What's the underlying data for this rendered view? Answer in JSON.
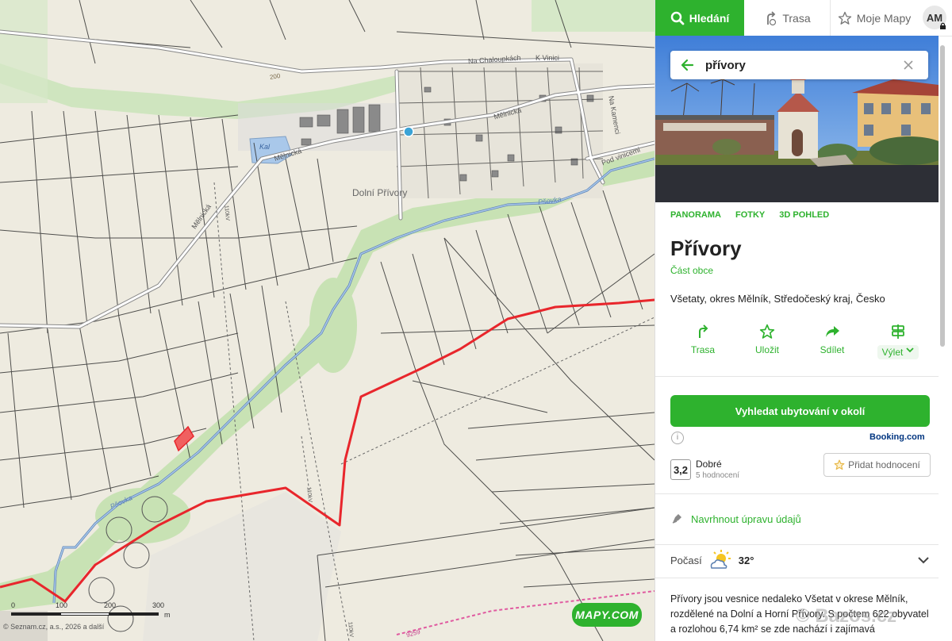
{
  "map": {
    "labels": {
      "village": "Dolní Přívory",
      "street_melnicka_1": "Mělnická",
      "street_melnicka_2": "Mělnická",
      "street_melnicka_3": "Mělnická",
      "street_chaloupkach": "Na Chaloupkách",
      "street_k_vinici": "K Vinici",
      "street_kamenci": "Na Kamenci",
      "street_pod_vinicemi": "Pod vinicemi",
      "stream_1": "Pšovka",
      "stream_2": "Pšovka",
      "pond": "Kal",
      "contour_200": "200",
      "powerline_1": "110kV",
      "powerline_2": "110kV",
      "powerline_3": "110kV",
      "road_num": "9259"
    },
    "scale": {
      "labels": [
        "0",
        "100",
        "200",
        "300"
      ],
      "unit": "m"
    },
    "copyright": "© Seznam.cz, a.s., 2026 a další",
    "logo": "MAPY.COM",
    "colors": {
      "route": "#e8262c",
      "stream": "#7f9fc4",
      "green": "#bfe0a8",
      "land": "#eeebe0"
    }
  },
  "panel": {
    "tabs": {
      "search": "Hledání",
      "route": "Trasa",
      "my_maps": "Moje Mapy"
    },
    "avatar": "AM",
    "search": {
      "query": "přívory"
    },
    "photo_links": {
      "panorama": "PANORAMA",
      "photos": "FOTKY",
      "view3d": "3D POHLED"
    },
    "place": {
      "title": "Přívory",
      "subtitle": "Část obce",
      "address": "Všetaty, okres Mělník, Středočeský kraj, Česko"
    },
    "actions": {
      "route": "Trasa",
      "save": "Uložit",
      "share": "Sdílet",
      "trip": "Výlet"
    },
    "booking": {
      "cta": "Vyhledat ubytování v okolí",
      "brand": "Booking.com"
    },
    "rating": {
      "score": "3,2",
      "word": "Dobré",
      "count": "5 hodnocení",
      "add": "Přidat hodnocení"
    },
    "suggest": "Navrhnout úpravu údajů",
    "weather": {
      "label": "Počasí",
      "temp": "32°"
    },
    "description": "Přívory jsou vesnice nedaleko Všetat v okrese Mělník, rozdělené na Dolní a Horní Přívory. S počtem 622 obyvatel a rozlohou 6,74 km² se zde nachází i zajímavá",
    "colors": {
      "accent": "#2eb22e",
      "booking": "#003580"
    }
  },
  "watermark": "© Bazos.cz"
}
